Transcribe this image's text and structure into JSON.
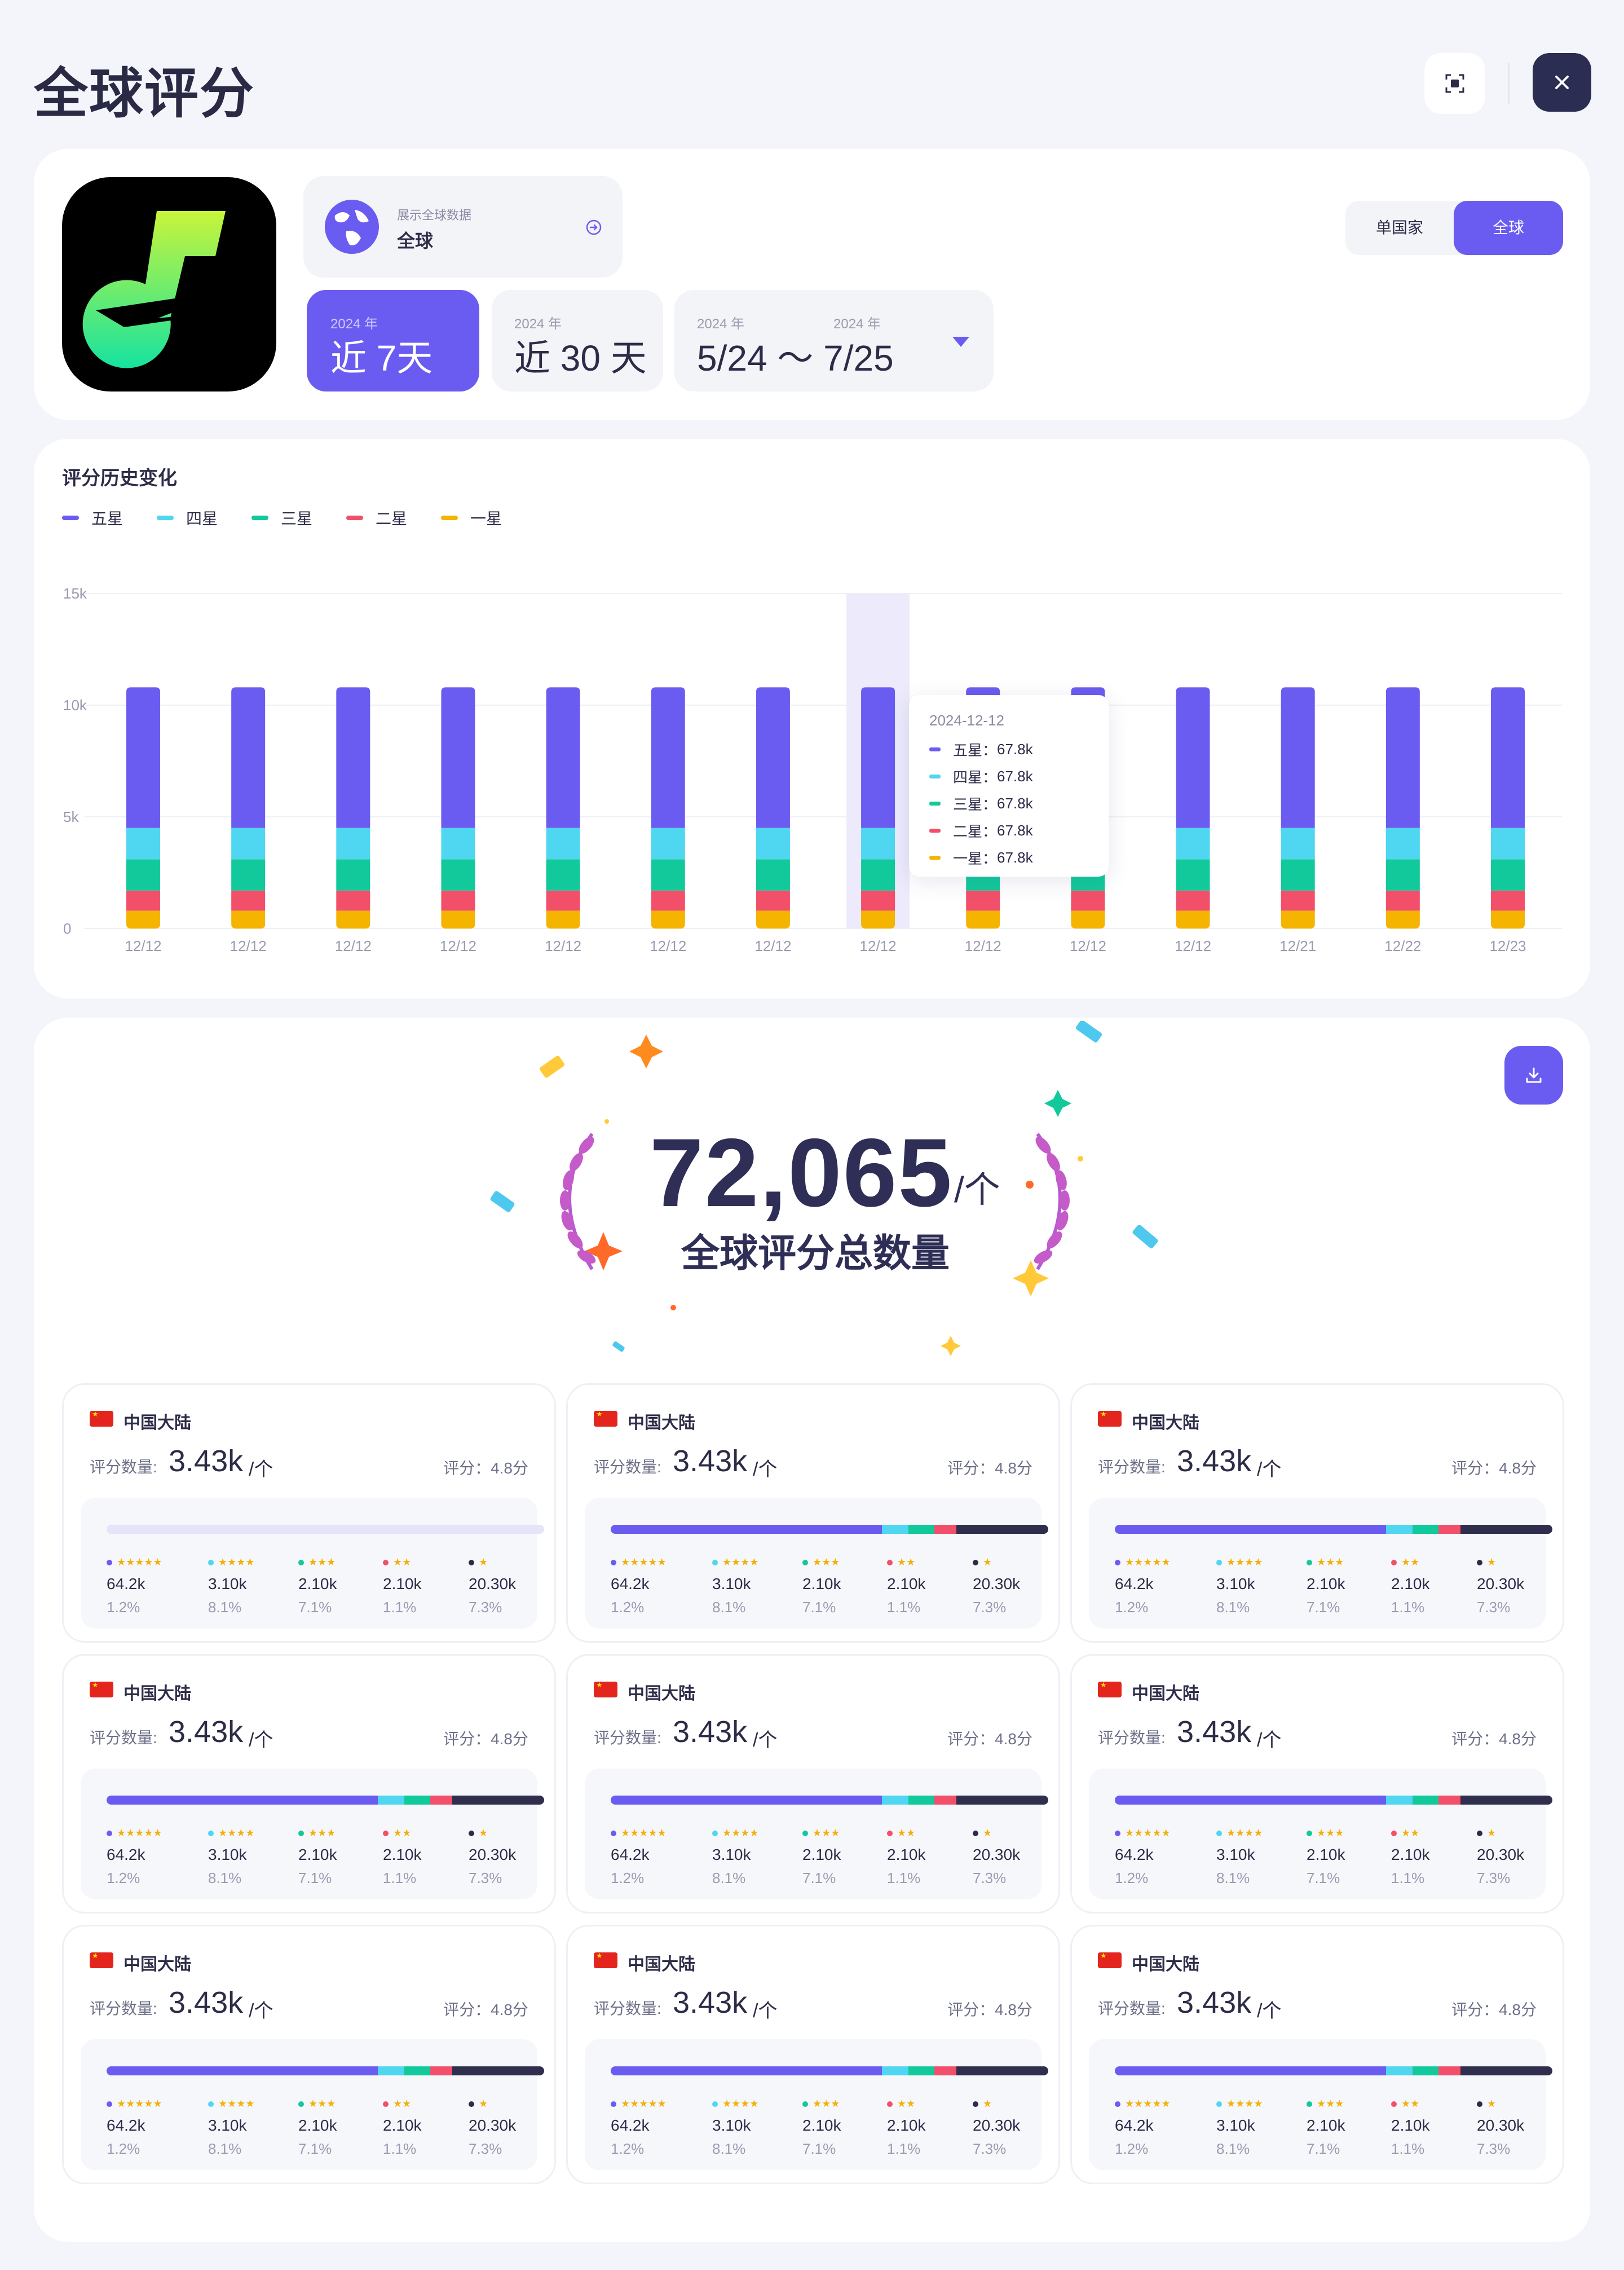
{
  "header": {
    "title": "全球评分"
  },
  "app": {
    "region_caption": "展示全球数据",
    "region_value": "全球",
    "ranges": [
      {
        "year": "2024 年",
        "label": "近 7天",
        "selected": true
      },
      {
        "year": "2024 年",
        "label": "近 30 天",
        "selected": false
      },
      {
        "year_start": "2024 年",
        "year_end": "2024 年",
        "label": "5/24 ～ 7/25",
        "selected": false
      }
    ],
    "scope_options": [
      "单国家",
      "全球"
    ],
    "scope_selected": "全球"
  },
  "chart": {
    "title": "评分历史变化",
    "tooltip": {
      "date": "2024-12-12",
      "rows": [
        {
          "label": "五星：",
          "value": "67.8k"
        },
        {
          "label": "四星：",
          "value": "67.8k"
        },
        {
          "label": "三星：",
          "value": "67.8k"
        },
        {
          "label": "二星：",
          "value": "67.8k"
        },
        {
          "label": "一星：",
          "value": "67.8k"
        }
      ]
    }
  },
  "chart_data": {
    "type": "bar",
    "stacked": true,
    "title": "评分历史变化",
    "legend_position": "top-left",
    "grid": true,
    "ylim": [
      0,
      15000
    ],
    "y_ticks": [
      "0",
      "5k",
      "10k",
      "15k"
    ],
    "categories": [
      "12/12",
      "12/12",
      "12/12",
      "12/12",
      "12/12",
      "12/12",
      "12/12",
      "12/12",
      "12/12",
      "12/12",
      "12/12",
      "12/21",
      "12/22",
      "12/23"
    ],
    "highlighted_index": 7,
    "series": [
      {
        "name": "一星",
        "color": "#f4b400",
        "values": [
          800,
          800,
          800,
          800,
          800,
          800,
          800,
          800,
          800,
          800,
          800,
          800,
          800,
          800
        ]
      },
      {
        "name": "二星",
        "color": "#f2506a",
        "values": [
          900,
          900,
          900,
          900,
          900,
          900,
          900,
          900,
          900,
          900,
          900,
          900,
          900,
          900
        ]
      },
      {
        "name": "三星",
        "color": "#12c99b",
        "values": [
          1400,
          1400,
          1400,
          1400,
          1400,
          1400,
          1400,
          1400,
          1400,
          1400,
          1400,
          1400,
          1400,
          1400
        ]
      },
      {
        "name": "四星",
        "color": "#4fd6f0",
        "values": [
          1400,
          1400,
          1400,
          1400,
          1400,
          1400,
          1400,
          1400,
          1400,
          1400,
          1400,
          1400,
          1400,
          1400
        ]
      },
      {
        "name": "五星",
        "color": "#6b5cf1",
        "values": [
          6300,
          6300,
          6300,
          6300,
          6300,
          6300,
          6300,
          6300,
          6300,
          6300,
          6300,
          6300,
          6300,
          6300
        ]
      }
    ]
  },
  "total": {
    "number": "72,065",
    "unit": "/个",
    "label": "全球评分总数量"
  },
  "country_cards": [
    {
      "country": "中国大陆",
      "count_label": "评分数量:",
      "count": "3.43k",
      "unit": "/个",
      "score": "评分：4.8分",
      "bar_fill": [
        0,
        0,
        0,
        0,
        0
      ],
      "stats": [
        {
          "stars": "★★★★★",
          "dot": "#6b5cf1",
          "value": "64.2k",
          "pct": "1.2%"
        },
        {
          "stars": "★★★★",
          "dot": "#4fd6f0",
          "value": "3.10k",
          "pct": "8.1%"
        },
        {
          "stars": "★★★",
          "dot": "#12c99b",
          "value": "2.10k",
          "pct": "7.1%"
        },
        {
          "stars": "★★",
          "dot": "#f2506a",
          "value": "2.10k",
          "pct": "1.1%"
        },
        {
          "stars": "★",
          "dot": "#2c2c48",
          "value": "20.30k",
          "pct": "7.3%"
        }
      ]
    },
    {
      "country": "中国大陆",
      "count_label": "评分数量:",
      "count": "3.43k",
      "unit": "/个",
      "score": "评分：4.8分",
      "bar_fill": [
        0.62,
        0.06,
        0.06,
        0.05,
        0.21
      ],
      "stats": [
        {
          "stars": "★★★★★",
          "dot": "#6b5cf1",
          "value": "64.2k",
          "pct": "1.2%"
        },
        {
          "stars": "★★★★",
          "dot": "#4fd6f0",
          "value": "3.10k",
          "pct": "8.1%"
        },
        {
          "stars": "★★★",
          "dot": "#12c99b",
          "value": "2.10k",
          "pct": "7.1%"
        },
        {
          "stars": "★★",
          "dot": "#f2506a",
          "value": "2.10k",
          "pct": "1.1%"
        },
        {
          "stars": "★",
          "dot": "#2c2c48",
          "value": "20.30k",
          "pct": "7.3%"
        }
      ]
    },
    {
      "country": "中国大陆",
      "count_label": "评分数量:",
      "count": "3.43k",
      "unit": "/个",
      "score": "评分：4.8分",
      "bar_fill": [
        0.62,
        0.06,
        0.06,
        0.05,
        0.21
      ],
      "stats": [
        {
          "stars": "★★★★★",
          "dot": "#6b5cf1",
          "value": "64.2k",
          "pct": "1.2%"
        },
        {
          "stars": "★★★★",
          "dot": "#4fd6f0",
          "value": "3.10k",
          "pct": "8.1%"
        },
        {
          "stars": "★★★",
          "dot": "#12c99b",
          "value": "2.10k",
          "pct": "7.1%"
        },
        {
          "stars": "★★",
          "dot": "#f2506a",
          "value": "2.10k",
          "pct": "1.1%"
        },
        {
          "stars": "★",
          "dot": "#2c2c48",
          "value": "20.30k",
          "pct": "7.3%"
        }
      ]
    },
    {
      "country": "中国大陆",
      "count_label": "评分数量:",
      "count": "3.43k",
      "unit": "/个",
      "score": "评分：4.8分",
      "bar_fill": [
        0.62,
        0.06,
        0.06,
        0.05,
        0.21
      ],
      "stats": [
        {
          "stars": "★★★★★",
          "dot": "#6b5cf1",
          "value": "64.2k",
          "pct": "1.2%"
        },
        {
          "stars": "★★★★",
          "dot": "#4fd6f0",
          "value": "3.10k",
          "pct": "8.1%"
        },
        {
          "stars": "★★★",
          "dot": "#12c99b",
          "value": "2.10k",
          "pct": "7.1%"
        },
        {
          "stars": "★★",
          "dot": "#f2506a",
          "value": "2.10k",
          "pct": "1.1%"
        },
        {
          "stars": "★",
          "dot": "#2c2c48",
          "value": "20.30k",
          "pct": "7.3%"
        }
      ]
    },
    {
      "country": "中国大陆",
      "count_label": "评分数量:",
      "count": "3.43k",
      "unit": "/个",
      "score": "评分：4.8分",
      "bar_fill": [
        0.62,
        0.06,
        0.06,
        0.05,
        0.21
      ],
      "stats": [
        {
          "stars": "★★★★★",
          "dot": "#6b5cf1",
          "value": "64.2k",
          "pct": "1.2%"
        },
        {
          "stars": "★★★★",
          "dot": "#4fd6f0",
          "value": "3.10k",
          "pct": "8.1%"
        },
        {
          "stars": "★★★",
          "dot": "#12c99b",
          "value": "2.10k",
          "pct": "7.1%"
        },
        {
          "stars": "★★",
          "dot": "#f2506a",
          "value": "2.10k",
          "pct": "1.1%"
        },
        {
          "stars": "★",
          "dot": "#2c2c48",
          "value": "20.30k",
          "pct": "7.3%"
        }
      ]
    },
    {
      "country": "中国大陆",
      "count_label": "评分数量:",
      "count": "3.43k",
      "unit": "/个",
      "score": "评分：4.8分",
      "bar_fill": [
        0.62,
        0.06,
        0.06,
        0.05,
        0.21
      ],
      "stats": [
        {
          "stars": "★★★★★",
          "dot": "#6b5cf1",
          "value": "64.2k",
          "pct": "1.2%"
        },
        {
          "stars": "★★★★",
          "dot": "#4fd6f0",
          "value": "3.10k",
          "pct": "8.1%"
        },
        {
          "stars": "★★★",
          "dot": "#12c99b",
          "value": "2.10k",
          "pct": "7.1%"
        },
        {
          "stars": "★★",
          "dot": "#f2506a",
          "value": "2.10k",
          "pct": "1.1%"
        },
        {
          "stars": "★",
          "dot": "#2c2c48",
          "value": "20.30k",
          "pct": "7.3%"
        }
      ]
    },
    {
      "country": "中国大陆",
      "count_label": "评分数量:",
      "count": "3.43k",
      "unit": "/个",
      "score": "评分：4.8分",
      "bar_fill": [
        0.62,
        0.06,
        0.06,
        0.05,
        0.21
      ],
      "stats": [
        {
          "stars": "★★★★★",
          "dot": "#6b5cf1",
          "value": "64.2k",
          "pct": "1.2%"
        },
        {
          "stars": "★★★★",
          "dot": "#4fd6f0",
          "value": "3.10k",
          "pct": "8.1%"
        },
        {
          "stars": "★★★",
          "dot": "#12c99b",
          "value": "2.10k",
          "pct": "7.1%"
        },
        {
          "stars": "★★",
          "dot": "#f2506a",
          "value": "2.10k",
          "pct": "1.1%"
        },
        {
          "stars": "★",
          "dot": "#2c2c48",
          "value": "20.30k",
          "pct": "7.3%"
        }
      ]
    },
    {
      "country": "中国大陆",
      "count_label": "评分数量:",
      "count": "3.43k",
      "unit": "/个",
      "score": "评分：4.8分",
      "bar_fill": [
        0.62,
        0.06,
        0.06,
        0.05,
        0.21
      ],
      "stats": [
        {
          "stars": "★★★★★",
          "dot": "#6b5cf1",
          "value": "64.2k",
          "pct": "1.2%"
        },
        {
          "stars": "★★★★",
          "dot": "#4fd6f0",
          "value": "3.10k",
          "pct": "8.1%"
        },
        {
          "stars": "★★★",
          "dot": "#12c99b",
          "value": "2.10k",
          "pct": "7.1%"
        },
        {
          "stars": "★★",
          "dot": "#f2506a",
          "value": "2.10k",
          "pct": "1.1%"
        },
        {
          "stars": "★",
          "dot": "#2c2c48",
          "value": "20.30k",
          "pct": "7.3%"
        }
      ]
    },
    {
      "country": "中国大陆",
      "count_label": "评分数量:",
      "count": "3.43k",
      "unit": "/个",
      "score": "评分：4.8分",
      "bar_fill": [
        0.62,
        0.06,
        0.06,
        0.05,
        0.21
      ],
      "stats": [
        {
          "stars": "★★★★★",
          "dot": "#6b5cf1",
          "value": "64.2k",
          "pct": "1.2%"
        },
        {
          "stars": "★★★★",
          "dot": "#4fd6f0",
          "value": "3.10k",
          "pct": "8.1%"
        },
        {
          "stars": "★★★",
          "dot": "#12c99b",
          "value": "2.10k",
          "pct": "7.1%"
        },
        {
          "stars": "★★",
          "dot": "#f2506a",
          "value": "2.10k",
          "pct": "1.1%"
        },
        {
          "stars": "★",
          "dot": "#2c2c48",
          "value": "20.30k",
          "pct": "7.3%"
        }
      ]
    }
  ],
  "colors": {
    "accent": "#6b5cf1",
    "dark": "#2b2d52",
    "bar_end": "#2f2e4d"
  },
  "icons": {
    "scan": "scan-icon",
    "close": "close-icon",
    "globe": "globe-icon",
    "arrow": "arrow-right-circle-icon",
    "dropdown": "caret-down-icon",
    "download": "download-icon",
    "laurel": "laurel-wreath-icon"
  }
}
